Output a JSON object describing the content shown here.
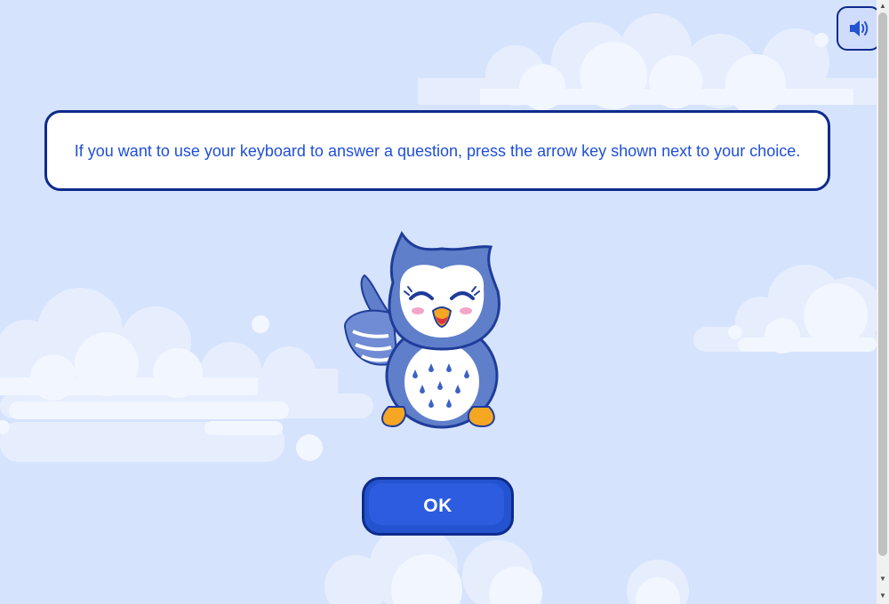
{
  "instruction": {
    "text": "If you want to use your keyboard to answer a question, press the arrow key shown next to your choice."
  },
  "buttons": {
    "ok_label": "OK",
    "sound_icon": "speaker-icon"
  },
  "mascot": {
    "icon": "owl-mascot"
  },
  "colors": {
    "background": "#d6e3fd",
    "accent": "#2453cf",
    "border": "#0e2a8c",
    "text": "#1f4fd8"
  },
  "scrollbar": {
    "up_icon": "scroll-up-arrow-icon",
    "down_icon": "scroll-down-arrow-icon"
  }
}
